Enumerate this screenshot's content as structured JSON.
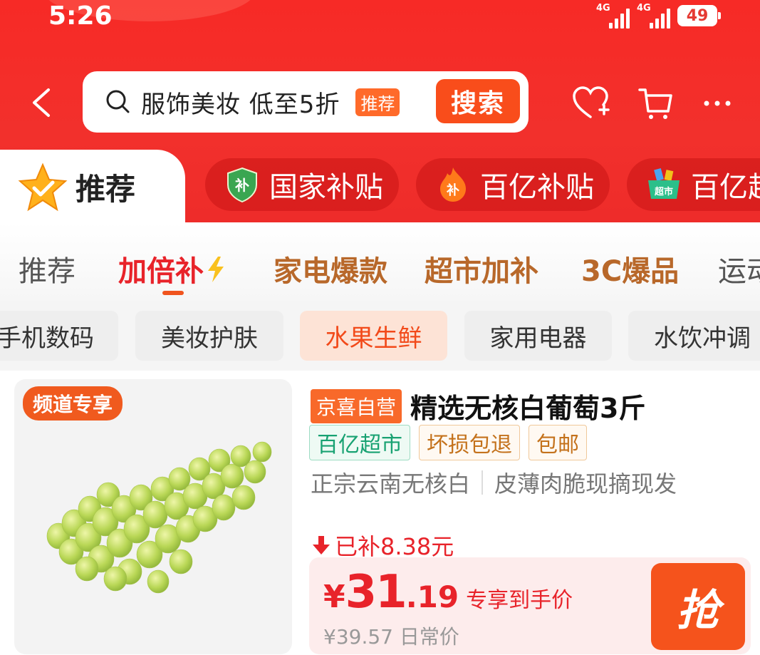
{
  "status_bar": {
    "time": "5:26",
    "network_1": "4G",
    "network_2": "4G",
    "battery": "49"
  },
  "search": {
    "placeholder": "服饰美妆 低至5折",
    "tag": "推荐",
    "button": "搜索"
  },
  "top_tabs": {
    "active": "推荐",
    "items": [
      {
        "label": "国家补贴",
        "icon": "shield-subsidy-icon",
        "icon_text": "补"
      },
      {
        "label": "百亿补贴",
        "icon": "flame-subsidy-icon",
        "icon_text": "补"
      },
      {
        "label": "百亿超",
        "icon": "supermarket-basket-icon",
        "icon_text": "超市"
      }
    ]
  },
  "sub_tabs": [
    "推荐",
    "加倍补",
    "家电爆款",
    "超市加补",
    "3C爆品",
    "运动"
  ],
  "categories": [
    "手机数码",
    "美妆护肤",
    "水果生鲜",
    "家用电器",
    "水饮冲调"
  ],
  "product": {
    "channel_badge": "频道专享",
    "self_label": "京喜自营",
    "name": "精选无核白葡萄3斤",
    "badges": [
      "百亿超市",
      "坏损包退",
      "包邮"
    ],
    "desc_1": "正宗云南无核白",
    "desc_2": "皮薄肉脆现摘现发",
    "subsidy": "已补8.38元",
    "price_symbol": "¥",
    "price_int": "31",
    "price_dec": ".19",
    "price_label": "专享到手价",
    "original_price": "¥39.57 日常价",
    "grab_button": "抢"
  },
  "colors": {
    "header_red": "#f72a26",
    "accent_orange": "#f5531c",
    "price_red": "#e8232a"
  }
}
